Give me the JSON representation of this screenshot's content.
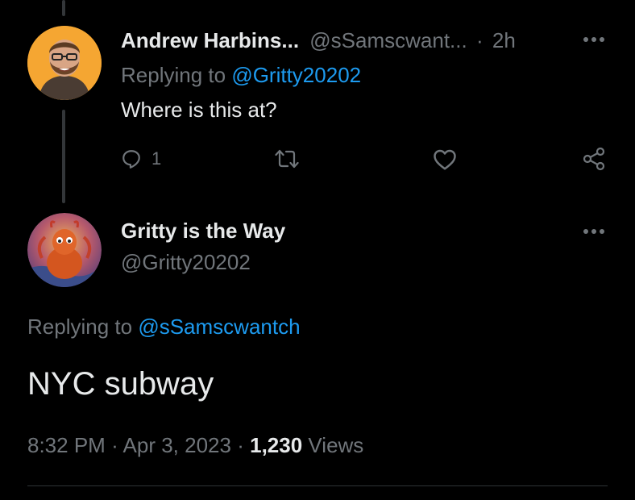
{
  "reply_tweet": {
    "display_name": "Andrew Harbins...",
    "handle": "@sSamscwant...",
    "separator": "·",
    "time_ago": "2h",
    "replying_prefix": "Replying to ",
    "replying_to": "@Gritty20202",
    "text": "Where is this at?",
    "reply_count": "1",
    "avatar_bg": "#f5a632"
  },
  "main_tweet": {
    "display_name": "Gritty is the Way",
    "handle": "@Gritty20202",
    "replying_prefix": "Replying to ",
    "replying_to": "@sSamscwantch",
    "text": "NYC subway",
    "time": "8:32 PM",
    "dot1": "·",
    "date": "Apr 3, 2023",
    "dot2": "·",
    "views_count": "1,230",
    "views_label": "Views"
  },
  "colors": {
    "background": "#000000",
    "primary_text": "#e7e9ea",
    "secondary_text": "#71767b",
    "link": "#1d9bf0"
  },
  "icons": {
    "more": "more-icon",
    "reply": "reply-icon",
    "retweet": "retweet-icon",
    "like": "heart-icon",
    "share": "share-icon"
  }
}
